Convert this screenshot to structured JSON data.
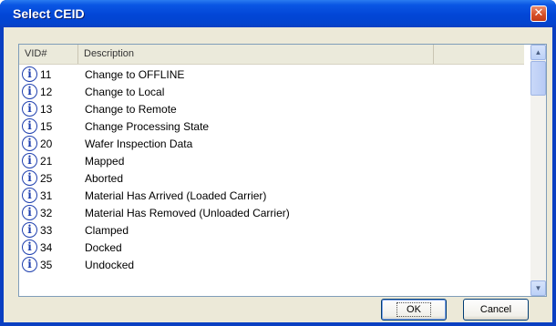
{
  "window": {
    "title": "Select CEID",
    "close_symbol": "✕"
  },
  "list": {
    "columns": [
      "VID#",
      "Description",
      ""
    ],
    "rows": [
      {
        "vid": "11",
        "description": "Change to OFFLINE"
      },
      {
        "vid": "12",
        "description": "Change to Local"
      },
      {
        "vid": "13",
        "description": "Change to Remote"
      },
      {
        "vid": "15",
        "description": "Change Processing State"
      },
      {
        "vid": "20",
        "description": "Wafer Inspection Data"
      },
      {
        "vid": "21",
        "description": "Mapped"
      },
      {
        "vid": "25",
        "description": "Aborted"
      },
      {
        "vid": "31",
        "description": "Material Has Arrived (Loaded Carrier)"
      },
      {
        "vid": "32",
        "description": "Material Has Removed (Unloaded Carrier)"
      },
      {
        "vid": "33",
        "description": "Clamped"
      },
      {
        "vid": "34",
        "description": "Docked"
      },
      {
        "vid": "35",
        "description": "Undocked"
      }
    ],
    "row_icon": "info-icon"
  },
  "scrollbar": {
    "up_symbol": "▲",
    "down_symbol": "▼"
  },
  "buttons": {
    "ok": "OK",
    "cancel": "Cancel"
  }
}
